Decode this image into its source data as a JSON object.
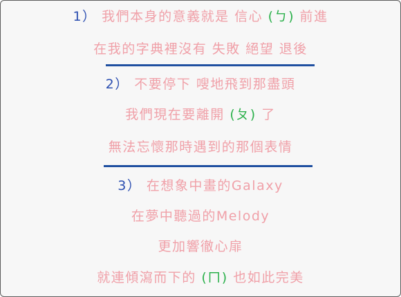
{
  "lines": [
    {
      "num": "1）",
      "text": "我們本身的意義就是 信心",
      "bopo": "(ㄅ)",
      "tail": "前進"
    },
    {
      "text": "在我的字典裡沒有 失敗 絕望 退後"
    },
    {
      "num": "2）",
      "text": "不要停下 嗖地飛到那盡頭"
    },
    {
      "text": "我們現在要離開",
      "bopo": "(ㄆ)",
      "tail": "了"
    },
    {
      "text": "無法忘懷那時遇到的那個表情"
    },
    {
      "num": "3）",
      "text": "在想象中畫的Galaxy"
    },
    {
      "text": "在夢中聽過的Melody"
    },
    {
      "text": "更加響徹心扉"
    },
    {
      "text": "就連傾瀉而下的",
      "bopo": "(ㄇ)",
      "tail": "也如此完美"
    }
  ],
  "colors": {
    "text": "#f0a0a8",
    "number": "#2a4db0",
    "bopomofo": "#2ab04a",
    "divider": "#1f4fa0"
  }
}
